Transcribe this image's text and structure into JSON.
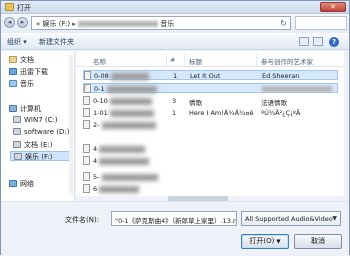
{
  "window": {
    "title": "打开",
    "close_label": "✕"
  },
  "address": {
    "back_label": "◂",
    "forward_label": "▸",
    "path_sep": "«",
    "path_part1": "娱乐 (F:)",
    "path_part2_suffix": "音乐",
    "refresh_label": "↻"
  },
  "toolbar": {
    "organize_label": "组织 ▾",
    "new_folder_label": "新建文件夹",
    "help_label": "?"
  },
  "nav": {
    "items": [
      {
        "label": "文档",
        "icon": "document-icon"
      },
      {
        "label": "迅雷下载",
        "icon": "download-icon"
      },
      {
        "label": "音乐",
        "icon": "music-icon"
      },
      {
        "label": "计算机",
        "icon": "computer-icon"
      },
      {
        "label": "WIN7 (C:)",
        "icon": "drive-icon"
      },
      {
        "label": "software (D:)",
        "icon": "drive-icon"
      },
      {
        "label": "文档 (E:)",
        "icon": "drive-icon"
      },
      {
        "label": "娱乐 (F:)",
        "icon": "drive-icon"
      },
      {
        "label": "网络",
        "icon": "network-icon"
      }
    ]
  },
  "list": {
    "columns": [
      "名称",
      "#",
      "标题",
      "参与创作的艺术家"
    ],
    "rows": [
      {
        "name": "0-08",
        "number": "1",
        "title": "Let It Out",
        "artist": "Ed Sheeran",
        "selected": true
      },
      {
        "name": "0-1",
        "number": "",
        "title": "",
        "artist": "",
        "selected": true
      },
      {
        "name": "0-10",
        "number": "3",
        "title": "情歌",
        "artist": "法语情歌",
        "selected": false
      },
      {
        "name": "1-01",
        "number": "1",
        "title": "Here I Am!Ä¾Ä¾¤ë",
        "artist": "ºÚ¼Ä²¿Ç¡ºÃ",
        "selected": false
      },
      {
        "name": "2-",
        "number": "",
        "title": "",
        "artist": "",
        "selected": false
      },
      {
        "name": "4",
        "number": "",
        "title": "",
        "artist": "",
        "selected": false
      },
      {
        "name": "4",
        "number": "",
        "title": "",
        "artist": "",
        "selected": false
      },
      {
        "name": "5-",
        "number": "",
        "title": "",
        "artist": "",
        "selected": false
      },
      {
        "name": "6",
        "number": "",
        "title": "",
        "artist": "",
        "selected": false
      }
    ]
  },
  "bottom": {
    "filename_label": "文件名(N):",
    "filename_value": "\"0-1《萨克斯曲4》（新郎草上家里）.13.n",
    "filetype_value": "All Supported Audio&Video",
    "open_label": "打开(O)",
    "cancel_label": "取消"
  }
}
